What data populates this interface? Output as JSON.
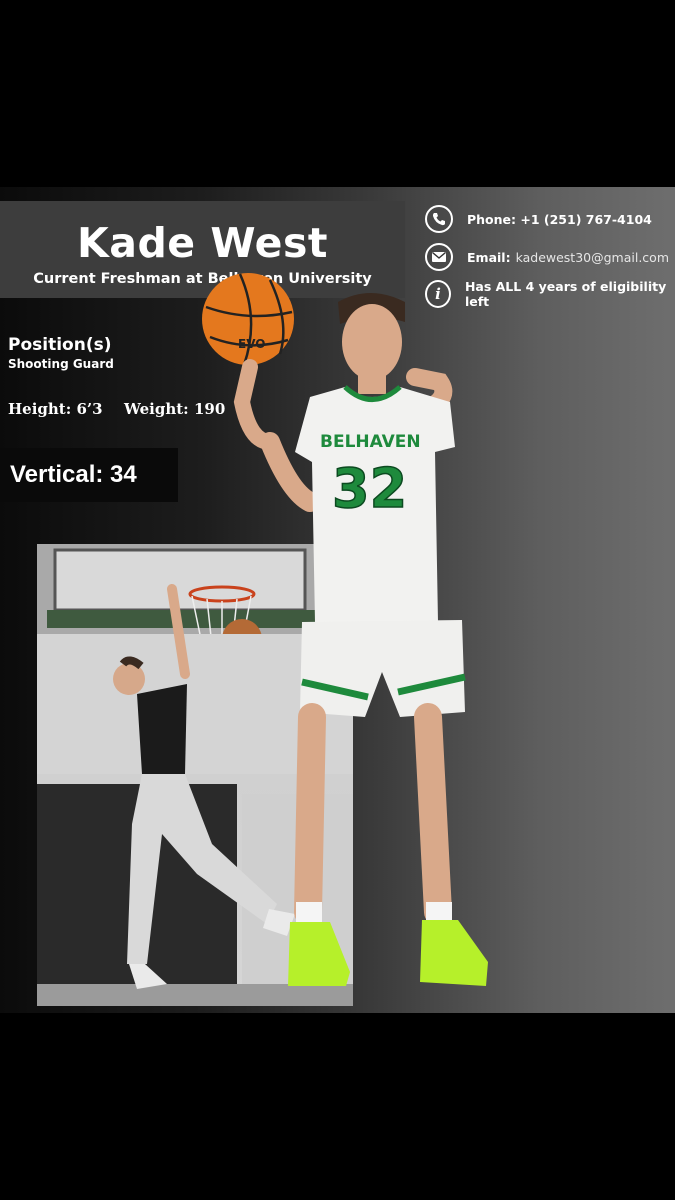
{
  "player": {
    "name": "Kade West",
    "subtitle": "Current Freshman at Belhaven University"
  },
  "contact": {
    "phone_label": "Phone: +1 (251) 767-4104",
    "email_label": "Email:",
    "email_value": "kadewest30@gmail.com",
    "eligibility": "Has ALL 4 years of eligibility left",
    "icons": [
      "phone-icon",
      "email-icon",
      "info-icon"
    ]
  },
  "stats": {
    "position_label": "Position(s)",
    "position_value": "Shooting Guard",
    "height": "Height: 6’3",
    "weight": "Weight: 190",
    "vertical": "Vertical: 34"
  },
  "basketball": {
    "brand": "EVO"
  },
  "jersey": {
    "team": "BELHAVEN",
    "number": "32"
  },
  "colors": {
    "jersey_green": "#1e8a3c",
    "shoe_neon": "#b6f02a",
    "ball_orange": "#e4781e",
    "vertical_box": "#0a0a0a"
  }
}
